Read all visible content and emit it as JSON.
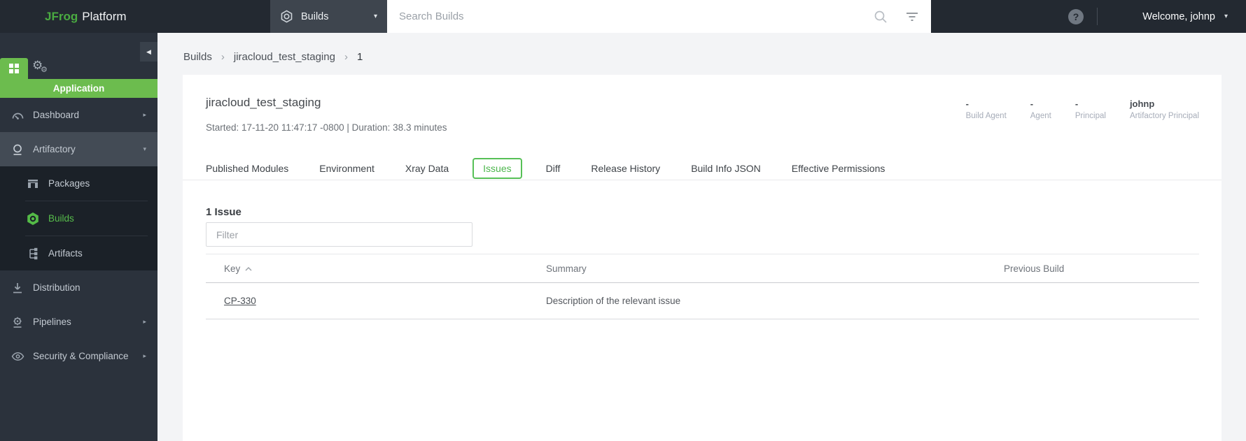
{
  "topbar": {
    "brand": "JFrog",
    "product": "Platform",
    "context_selector_label": "Builds",
    "context_caret": "▾",
    "search_placeholder": "Search Builds",
    "help_label": "?",
    "welcome_label": "Welcome, johnp",
    "welcome_caret": "▾"
  },
  "sidebar": {
    "collapse_glyph": "◀",
    "application_banner": "Application",
    "gear_glyph": "⚙",
    "items": {
      "dashboard": {
        "label": "Dashboard",
        "caret": "▸"
      },
      "artifactory": {
        "label": "Artifactory",
        "caret": "▾"
      },
      "distribution": {
        "label": "Distribution",
        "caret": ""
      },
      "pipelines": {
        "label": "Pipelines",
        "caret": "▸"
      },
      "security": {
        "label": "Security & Compliance",
        "caret": "▸"
      }
    },
    "subitems": {
      "packages": "Packages",
      "builds": "Builds",
      "artifacts": "Artifacts"
    }
  },
  "breadcrumb": {
    "items": [
      "Builds",
      "jiracloud_test_staging",
      "1"
    ],
    "separator": "›"
  },
  "build": {
    "name": "jiracloud_test_staging",
    "started_line": "Started: 17-11-20 11:47:17 -0800 | Duration: 38.3 minutes",
    "meta": [
      {
        "value": "-",
        "label": "Build Agent"
      },
      {
        "value": "-",
        "label": "Agent"
      },
      {
        "value": "-",
        "label": "Principal"
      },
      {
        "value": "johnp",
        "label": "Artifactory Principal"
      }
    ]
  },
  "tabs": [
    {
      "label": "Published Modules"
    },
    {
      "label": "Environment"
    },
    {
      "label": "Xray Data"
    },
    {
      "label": "Issues",
      "active": true
    },
    {
      "label": "Diff"
    },
    {
      "label": "Release History"
    },
    {
      "label": "Build Info JSON"
    },
    {
      "label": "Effective Permissions"
    }
  ],
  "issues": {
    "heading": "1 Issue",
    "filter_placeholder": "Filter",
    "table": {
      "columns": [
        "Key",
        "Summary",
        "Previous Build"
      ],
      "rows": [
        {
          "key": "CP-330",
          "summary": "Description of the relevant issue",
          "previous_build": ""
        }
      ]
    }
  },
  "colors": {
    "brand_green": "#4aab41",
    "banner_green": "#6cbc4e",
    "active_tab_green": "#53bb53",
    "topbar_bg": "#232931",
    "sidebar_bg": "#2b323c",
    "subnav_bg": "#1b2128",
    "page_bg": "#f3f4f6"
  }
}
